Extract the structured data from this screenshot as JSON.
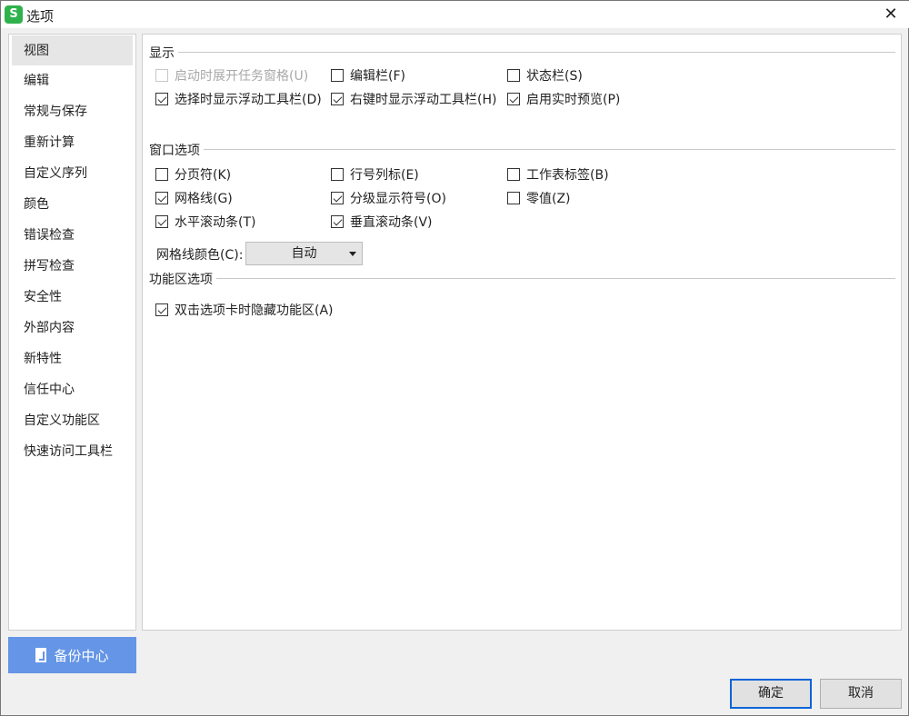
{
  "window": {
    "title": "选项",
    "logo": "S",
    "close": "✕"
  },
  "sidebar": {
    "items": [
      {
        "label": "视图",
        "selected": true
      },
      {
        "label": "编辑"
      },
      {
        "label": "常规与保存"
      },
      {
        "label": "重新计算"
      },
      {
        "label": "自定义序列"
      },
      {
        "label": "颜色"
      },
      {
        "label": "错误检查"
      },
      {
        "label": "拼写检查"
      },
      {
        "label": "安全性"
      },
      {
        "label": "外部内容"
      },
      {
        "label": "新特性"
      },
      {
        "label": "信任中心"
      },
      {
        "label": "自定义功能区"
      },
      {
        "label": "快速访问工具栏"
      }
    ]
  },
  "display": {
    "title": "显示",
    "options": [
      {
        "label": "启动时展开任务窗格(U)",
        "checked": false,
        "disabled": true
      },
      {
        "label": "编辑栏(F)",
        "checked": false
      },
      {
        "label": "状态栏(S)",
        "checked": false
      },
      {
        "label": "选择时显示浮动工具栏(D)",
        "checked": true
      },
      {
        "label": "右键时显示浮动工具栏(H)",
        "checked": true
      },
      {
        "label": "启用实时预览(P)",
        "checked": true
      }
    ]
  },
  "window_options": {
    "title": "窗口选项",
    "options": [
      {
        "label": "分页符(K)",
        "checked": false
      },
      {
        "label": "行号列标(E)",
        "checked": false
      },
      {
        "label": "工作表标签(B)",
        "checked": false
      },
      {
        "label": "网格线(G)",
        "checked": true
      },
      {
        "label": "分级显示符号(O)",
        "checked": true
      },
      {
        "label": "零值(Z)",
        "checked": false
      },
      {
        "label": "水平滚动条(T)",
        "checked": true
      },
      {
        "label": "垂直滚动条(V)",
        "checked": true
      }
    ],
    "grid_color_label": "网格线颜色(C):",
    "grid_color_value": "自动"
  },
  "ribbon": {
    "title": "功能区选项",
    "options": [
      {
        "label": "双击选项卡时隐藏功能区(A)",
        "checked": true
      }
    ]
  },
  "footer": {
    "backup": "备份中心",
    "ok": "确定",
    "cancel": "取消"
  },
  "colors": {
    "accent": "#6495e6",
    "ok_border": "#0a64d8",
    "logo": "#2fb24c"
  }
}
